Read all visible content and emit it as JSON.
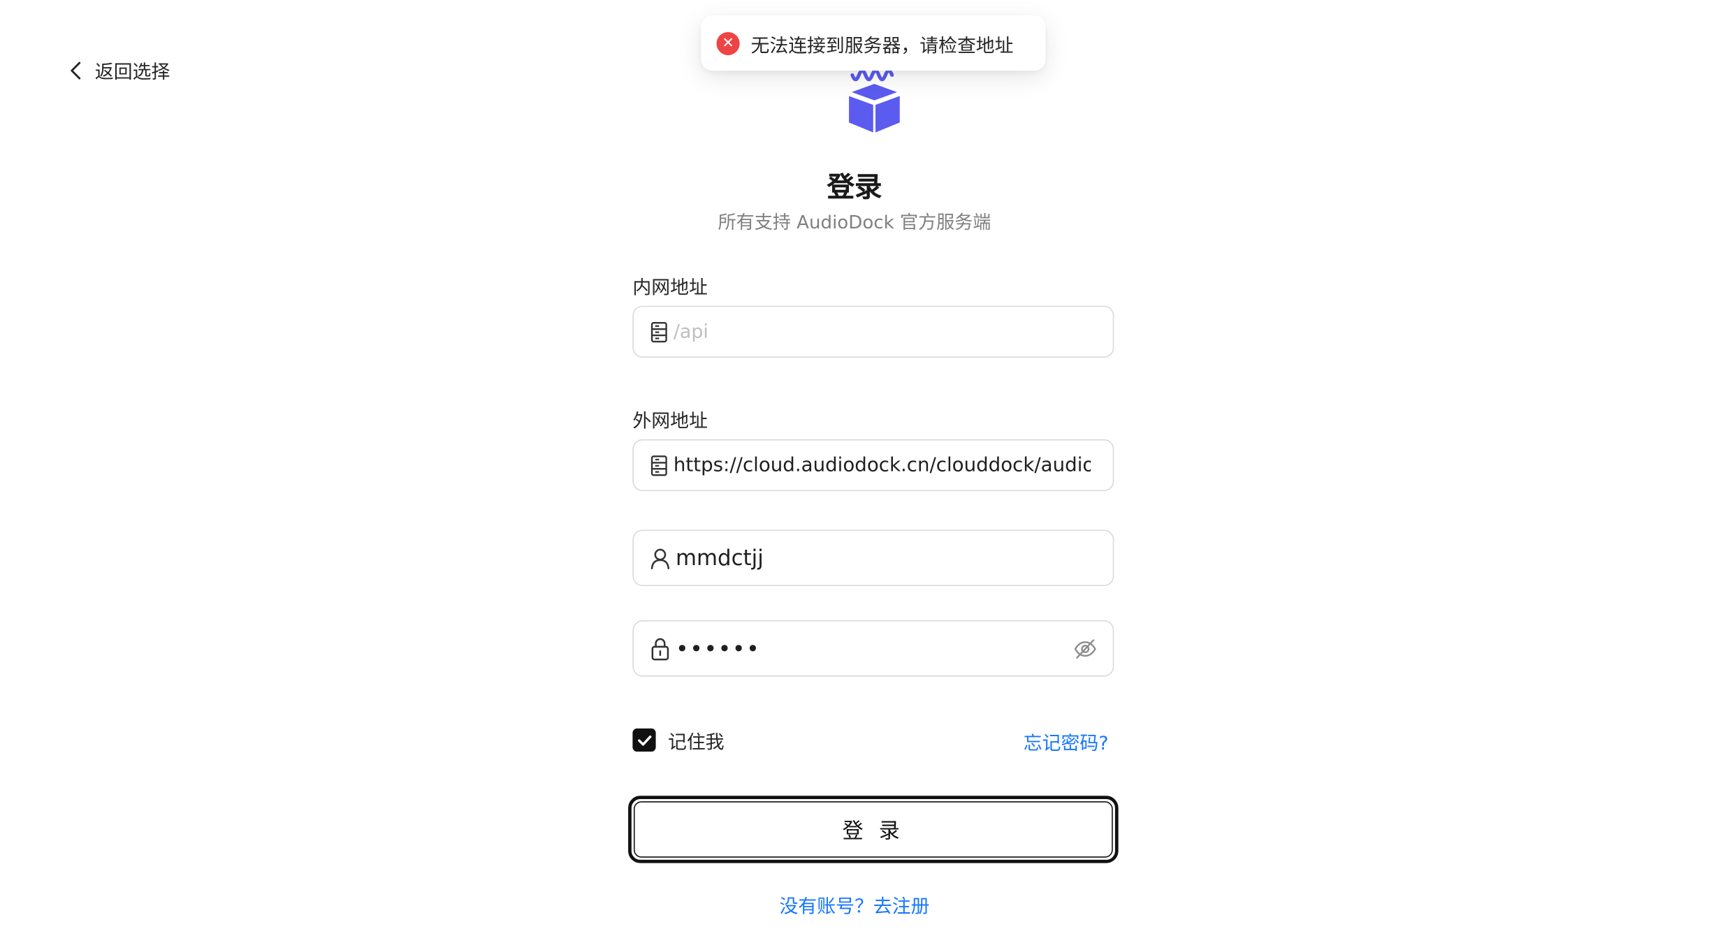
{
  "nav": {
    "back_label": "返回选择"
  },
  "toast": {
    "message": "无法连接到服务器，请检查地址",
    "type": "error"
  },
  "header": {
    "title": "登录",
    "subtitle": "所有支持 AudioDock 官方服务端"
  },
  "form": {
    "internal": {
      "label": "内网地址",
      "value": "",
      "placeholder": "/api",
      "icon": "server-icon"
    },
    "external": {
      "label": "外网地址",
      "value": "https://cloud.audiodock.cn/clouddock/audiodock",
      "icon": "server-icon"
    },
    "username": {
      "value": "mmdctjj",
      "icon": "user-icon"
    },
    "password": {
      "masked_value": "••••••",
      "icon": "lock-icon",
      "toggle_icon": "eye-off-icon"
    },
    "remember_label": "记住我",
    "remember_checked": true,
    "forgot_label": "忘记密码?",
    "submit_label": "登 录",
    "register_label": "没有账号？去注册"
  },
  "colors": {
    "accent": "#1677ff",
    "error": "#ef4444",
    "brand": "#5b5bf0",
    "button_border": "#111111"
  }
}
